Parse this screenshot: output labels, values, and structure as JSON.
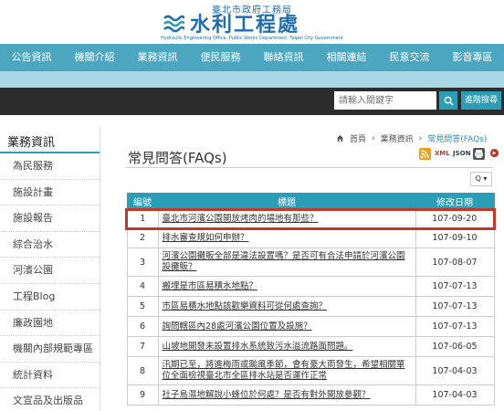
{
  "header": {
    "subtitle": "臺北市政府工務局",
    "title": "水利工程處",
    "english": "Hydraulic Engineering Office, Public Works Department, Taipei City Government"
  },
  "nav": [
    "公告資訊",
    "機關介紹",
    "業務資訊",
    "便民服務",
    "聯絡資訊",
    "相關連結",
    "民意交流",
    "影音專區"
  ],
  "search": {
    "placeholder": "請輸入關鍵字",
    "advanced_label": "進階搜尋"
  },
  "sidebar": {
    "title": "業務資訊",
    "items": [
      "為民服務",
      "施設計畫",
      "施設報告",
      "綜合治水",
      "河濱公園",
      "工程Blog",
      "廉政園地",
      "機關內部規範專區",
      "統計資料",
      "文宣品及出版品"
    ]
  },
  "breadcrumb": {
    "home": "首頁",
    "section": "業務資訊",
    "current": "常見問答(FAQs)"
  },
  "page": {
    "title": "常見問答(FAQs)"
  },
  "share": {
    "rss": "RSS",
    "xml": "XML",
    "json": "JSON"
  },
  "sort_label": "Q ▾",
  "table": {
    "headers": {
      "no": "編號",
      "title": "標題",
      "date": "修改日期"
    },
    "rows": [
      {
        "no": "1",
        "title": "臺北市河濱公園開放烤肉的場地有那些？",
        "date": "107-09-20"
      },
      {
        "no": "2",
        "title": "排水審查規如何申辦？",
        "date": "107-09-10"
      },
      {
        "no": "3",
        "title": "河濱公園攤販全部是違法設置嗎？是否可有合法申請於河濱公園設攤販？",
        "date": "107-08-07"
      },
      {
        "no": "4",
        "title": "搬埋是市區易積水地點？",
        "date": "107-07-13"
      },
      {
        "no": "5",
        "title": "市區易積水地點該歡樂資料可從何處查詢？",
        "date": "107-07-13"
      },
      {
        "no": "6",
        "title": "詢問轄區內28處河濱公園位置及設施？",
        "date": "107-07-13"
      },
      {
        "no": "7",
        "title": "山坡地開發未設置排水系統致污水溢流路面問題。",
        "date": "107-06-05"
      },
      {
        "no": "8",
        "title": "汛期已至，將進梅雨或颱風季節，會有豪大雨發生，希望相關單位全面檢視臺北市全區排水站是否運作正常",
        "date": "107-04-03"
      },
      {
        "no": "9",
        "title": "社子島濕地解說小蜂位於何處？是否有對外開放參觀？",
        "date": "107-04-03"
      }
    ]
  }
}
